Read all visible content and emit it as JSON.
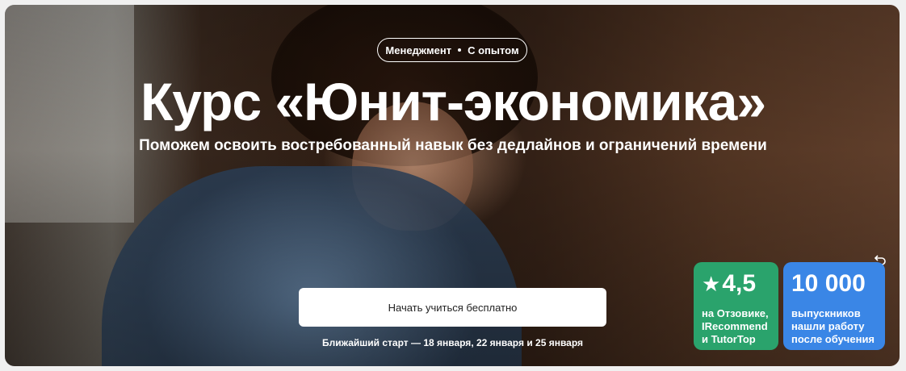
{
  "tag": {
    "category": "Менеджмент",
    "level": "С опытом"
  },
  "title": "Курс «Юнит-экономика»",
  "subtitle": "Поможем освоить востребованный навык без дедлайнов и ограничений времени",
  "cta_label": "Начать учиться бесплатно",
  "start_dates": "Ближайший старт — 18 января, 22 января и 25 января",
  "rating_card": {
    "value": "4,5",
    "text": "на Отзовике, IRecommend и TutorTop",
    "icon": "star-icon",
    "color": "#2aa36c"
  },
  "graduates_card": {
    "value": "10 000",
    "text": "выпускников нашли работу после обучения",
    "color": "#3a86e6"
  },
  "corner_icon": "undo-icon"
}
